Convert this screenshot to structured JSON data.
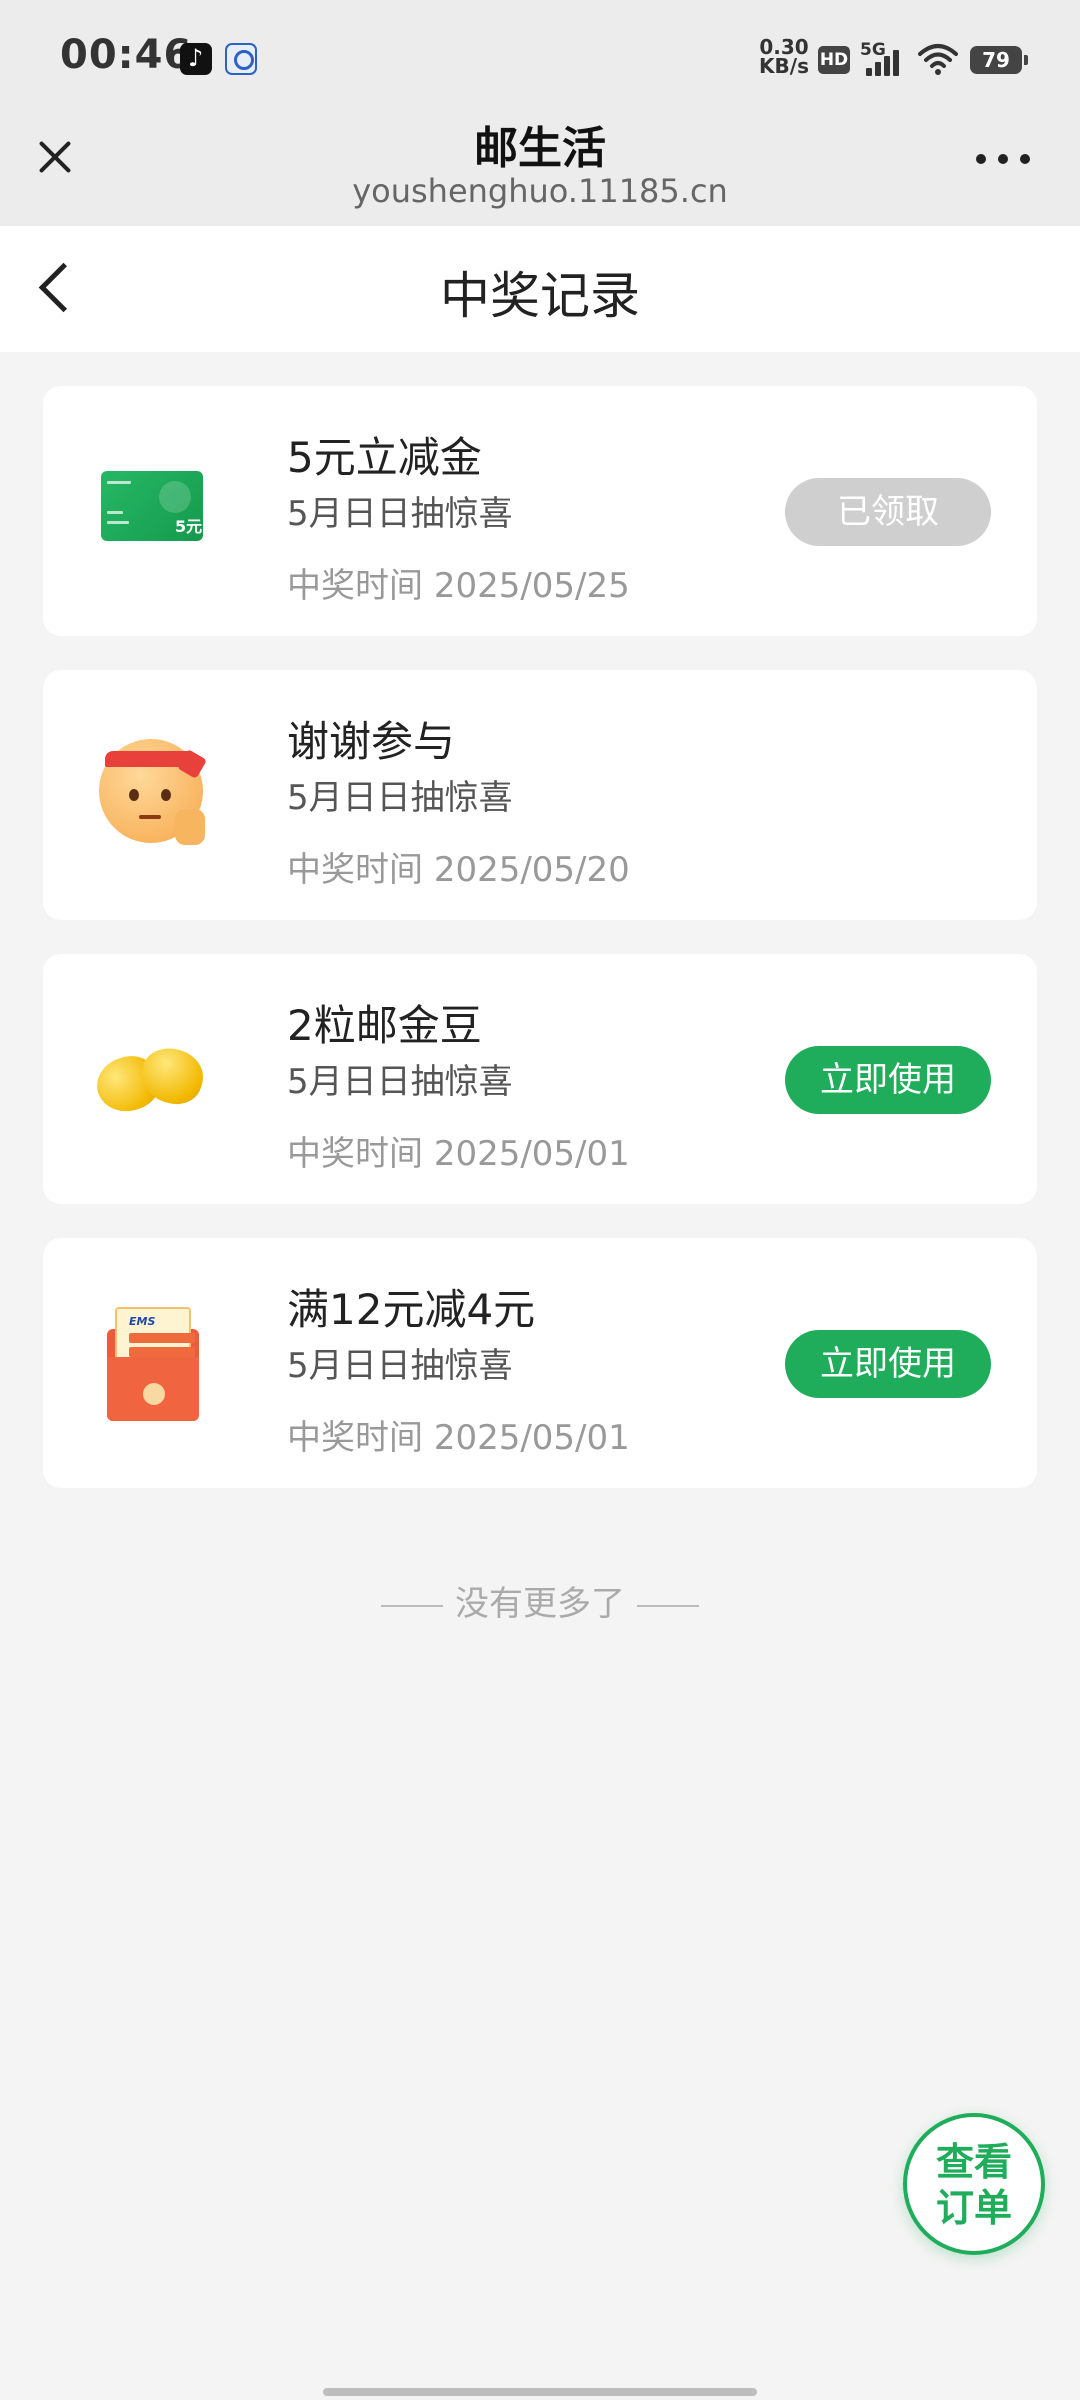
{
  "status_bar": {
    "time": "00:46",
    "net_speed_value": "0.30",
    "net_speed_unit": "KB/s",
    "hd_label": "HD",
    "network_label": "5G",
    "battery": "79"
  },
  "browser": {
    "title": "邮生活",
    "url": "youshenghuo.11185.cn"
  },
  "page": {
    "title": "中奖记录"
  },
  "records": [
    {
      "title": "5元立减金",
      "activity": "5月日日抽惊喜",
      "time_label": "中奖时间",
      "time_value": "2025/05/25",
      "button": "已领取",
      "icon": "cash-card-icon",
      "card_text": "5元"
    },
    {
      "title": "谢谢参与",
      "activity": "5月日日抽惊喜",
      "time_label": "中奖时间",
      "time_value": "2025/05/20",
      "icon": "emoji-fighting-icon"
    },
    {
      "title": "2粒邮金豆",
      "activity": "5月日日抽惊喜",
      "time_label": "中奖时间",
      "time_value": "2025/05/01",
      "button": "立即使用",
      "icon": "gold-beans-icon"
    },
    {
      "title": "满12元减4元",
      "activity": "5月日日抽惊喜",
      "time_label": "中奖时间",
      "time_value": "2025/05/01",
      "button": "立即使用",
      "icon": "coupon-envelope-icon",
      "envelope_text": "EMS"
    }
  ],
  "footer": {
    "no_more": "没有更多了"
  },
  "fab": {
    "line1": "查看",
    "line2": "订单"
  },
  "colors": {
    "primary_green": "#20ad5b",
    "disabled_gray": "#cfcfcf",
    "page_background": "#f4f4f4"
  }
}
